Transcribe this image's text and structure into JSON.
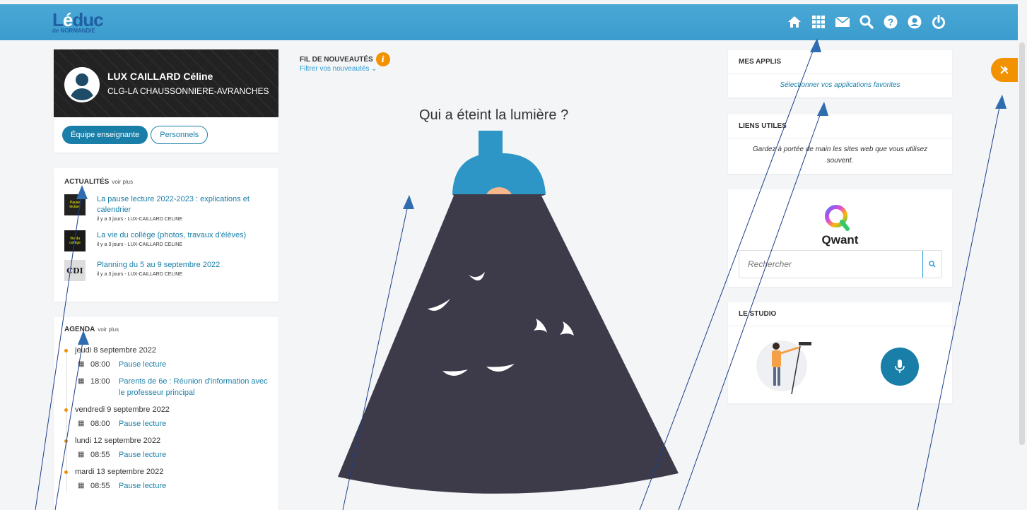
{
  "header": {
    "logo_main_prefix": "L",
    "logo_main_e": "é",
    "logo_main_suffix": "duc",
    "logo_sub": "de NORMANDIE",
    "icons": [
      "home-icon",
      "apps-grid-icon",
      "mail-icon",
      "search-icon",
      "help-icon",
      "user-icon",
      "power-icon"
    ],
    "color": "#3b9ccd"
  },
  "profile": {
    "name": "LUX CAILLARD Céline",
    "school": "CLG-LA CHAUSSONNIERE-AVRANCHES",
    "btn_team": "Équipe enseignante",
    "btn_staff": "Personnels"
  },
  "news": {
    "title": "ACTUALITÉS",
    "more": "voir plus",
    "items": [
      {
        "thumb": "Pause lecture",
        "title": "La pause lecture 2022-2023 : explications et calendrier",
        "meta": "il y a 3 jours - LUX-CAILLARD CELINE"
      },
      {
        "thumb": "Vie du collège",
        "title": "La vie du collège (photos, travaux d'élèves)",
        "meta": "il y a 3 jours - LUX-CAILLARD CELINE"
      },
      {
        "thumb": "CDI",
        "title": "Planning du 5 au 9 septembre 2022",
        "meta": "il y a 3 jours - LUX-CAILLARD CELINE"
      }
    ]
  },
  "agenda": {
    "title": "AGENDA",
    "more": "voir plus",
    "days": [
      {
        "day": "jeudi 8 septembre 2022",
        "events": [
          {
            "time": "08:00",
            "title": "Pause lecture"
          },
          {
            "time": "18:00",
            "title": "Parents de 6e : Réunion d'information avec le professeur principal"
          }
        ]
      },
      {
        "day": "vendredi 9 septembre 2022",
        "events": [
          {
            "time": "08:00",
            "title": "Pause lecture"
          }
        ]
      },
      {
        "day": "lundi 12 septembre 2022",
        "events": [
          {
            "time": "08:55",
            "title": "Pause lecture"
          }
        ]
      },
      {
        "day": "mardi 13 septembre 2022",
        "events": [
          {
            "time": "08:55",
            "title": "Pause lecture"
          }
        ]
      }
    ]
  },
  "feed": {
    "title": "FIL DE NOUVEAUTÉS",
    "info": "i",
    "filter": "Filtrer vos nouveautés",
    "empty_title": "Qui a éteint la lumière ?"
  },
  "apps": {
    "title": "MES APPLIS",
    "link": "Sélectionner vos applications favorites"
  },
  "links": {
    "title": "LIENS UTILES",
    "text": "Gardez à portée de main les sites web que vous utilisez souvent."
  },
  "qwant": {
    "name": "Qwant",
    "placeholder": "Rechercher"
  },
  "studio": {
    "title": "LE STUDIO"
  },
  "colors": {
    "accent": "#1a7fa8",
    "orange": "#f39200",
    "lamp_shade": "#2e96c6",
    "dark": "#3d3b4a"
  }
}
